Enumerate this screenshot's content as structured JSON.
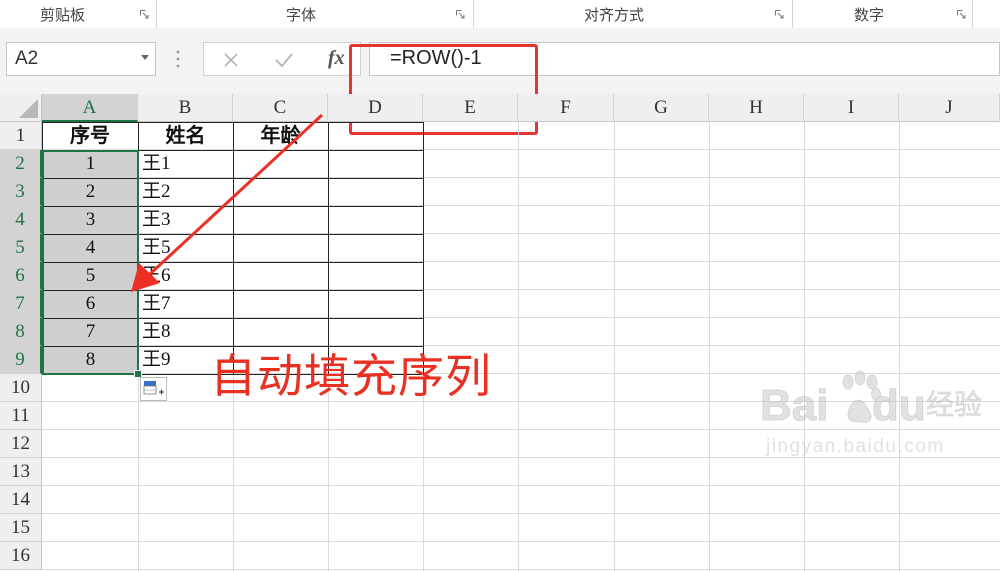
{
  "ribbon": {
    "groups": [
      {
        "label": "剪贴板"
      },
      {
        "label": "字体"
      },
      {
        "label": "对齐方式"
      },
      {
        "label": "数字"
      }
    ]
  },
  "formula_bar": {
    "name_box": "A2",
    "formula": "=ROW()-1",
    "icons": [
      "cancel-icon",
      "enter-icon",
      "fx-icon"
    ],
    "fx_label": "fx"
  },
  "sheet": {
    "columns": [
      "A",
      "B",
      "C",
      "D",
      "E",
      "F",
      "G",
      "H",
      "I",
      "J"
    ],
    "rows": [
      "1",
      "2",
      "3",
      "4",
      "5",
      "6",
      "7",
      "8",
      "9",
      "10",
      "11",
      "12",
      "13",
      "14",
      "15",
      "16"
    ],
    "selected_column": "A",
    "selected_rows": [
      "2",
      "3",
      "4",
      "5",
      "6",
      "7",
      "8",
      "9"
    ],
    "header_row": {
      "a": "序号",
      "b": "姓名",
      "c": "年龄"
    },
    "data": [
      {
        "a": "1",
        "b": "王1"
      },
      {
        "a": "2",
        "b": "王2"
      },
      {
        "a": "3",
        "b": "王3"
      },
      {
        "a": "4",
        "b": "王5"
      },
      {
        "a": "5",
        "b": "王6"
      },
      {
        "a": "6",
        "b": "王7"
      },
      {
        "a": "7",
        "b": "王8"
      },
      {
        "a": "8",
        "b": "王9"
      }
    ]
  },
  "annotation": {
    "text": "自动填充序列",
    "color": "#ea2f23"
  },
  "watermark": {
    "brand": "Bai",
    "brand2": "du",
    "suffix": "经验",
    "url": "jingyan.baidu.com"
  },
  "colors": {
    "accent_green": "#217346",
    "annotation_red": "#e8342c"
  }
}
